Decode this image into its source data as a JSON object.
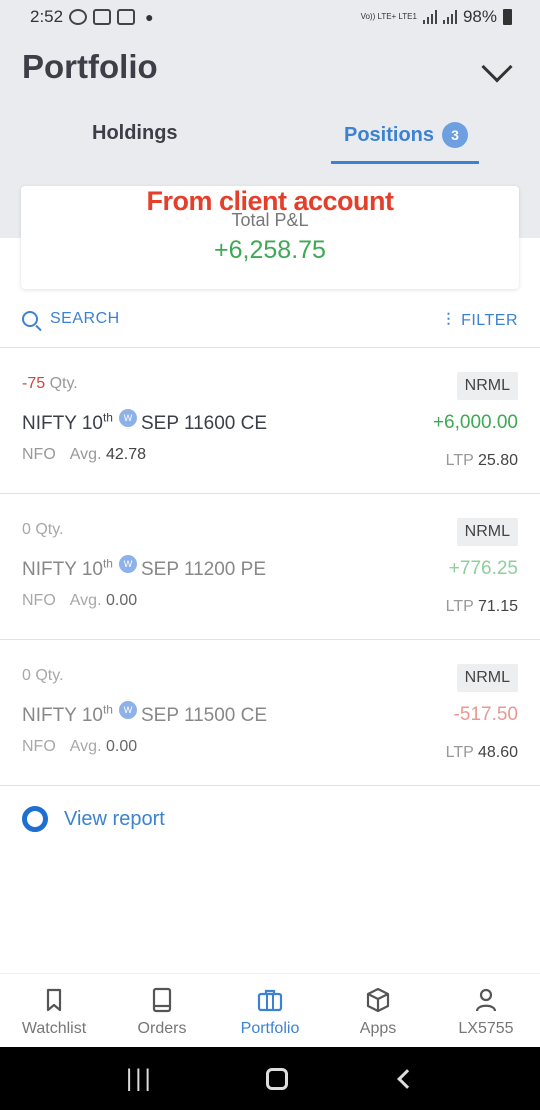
{
  "status_bar": {
    "time": "2:52",
    "network": "Vo)) LTE+ LTE1",
    "battery": "98%"
  },
  "header": {
    "title": "Portfolio",
    "tabs": [
      {
        "label": "Holdings",
        "active": false
      },
      {
        "label": "Positions",
        "active": true,
        "badge": "3"
      }
    ]
  },
  "summary": {
    "watermark": "From client account",
    "label": "Total P&L",
    "value": "+6,258.75"
  },
  "toolbar": {
    "search_label": "SEARCH",
    "filter_label": "FILTER"
  },
  "positions": [
    {
      "qty": "-75",
      "qty_label": "Qty.",
      "name_prefix": "NIFTY 10",
      "name_sup": "th",
      "weekly_badge": "W",
      "name_suffix": "SEP 11600 CE",
      "exchange": "NFO",
      "avg_label": "Avg.",
      "avg_value": "42.78",
      "product": "NRML",
      "pnl": "+6,000.00",
      "pnl_sign": "positive",
      "ltp_label": "LTP",
      "ltp_value": "25.80",
      "faded": false
    },
    {
      "qty": "0",
      "qty_label": "Qty.",
      "name_prefix": "NIFTY 10",
      "name_sup": "th",
      "weekly_badge": "W",
      "name_suffix": "SEP 11200 PE",
      "exchange": "NFO",
      "avg_label": "Avg.",
      "avg_value": "0.00",
      "product": "NRML",
      "pnl": "+776.25",
      "pnl_sign": "positive",
      "ltp_label": "LTP",
      "ltp_value": "71.15",
      "faded": true
    },
    {
      "qty": "0",
      "qty_label": "Qty.",
      "name_prefix": "NIFTY 10",
      "name_sup": "th",
      "weekly_badge": "W",
      "name_suffix": "SEP 11500 CE",
      "exchange": "NFO",
      "avg_label": "Avg.",
      "avg_value": "0.00",
      "product": "NRML",
      "pnl": "-517.50",
      "pnl_sign": "negative",
      "ltp_label": "LTP",
      "ltp_value": "48.60",
      "faded": true
    }
  ],
  "report": {
    "label": "View report"
  },
  "bottom_nav": [
    {
      "label": "Watchlist",
      "icon": "bookmark-icon",
      "active": false
    },
    {
      "label": "Orders",
      "icon": "book-icon",
      "active": false
    },
    {
      "label": "Portfolio",
      "icon": "briefcase-icon",
      "active": true
    },
    {
      "label": "Apps",
      "icon": "cube-icon",
      "active": false
    },
    {
      "label": "LX5755",
      "icon": "user-icon",
      "active": false
    }
  ],
  "colors": {
    "accent": "#3c82d2",
    "positive": "#3fa855",
    "negative": "#d0463a",
    "watermark": "#e53e2a"
  }
}
